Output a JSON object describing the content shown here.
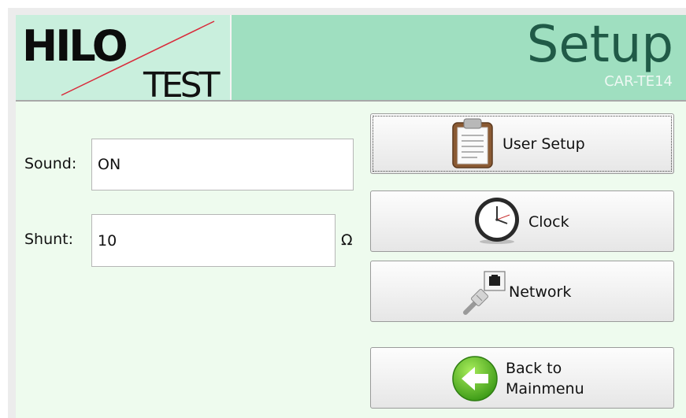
{
  "header": {
    "logo_top": "HILO",
    "logo_bottom": "TEST",
    "title": "Setup",
    "subtitle": "CAR-TE14"
  },
  "fields": {
    "sound_label": "Sound:",
    "sound_value": "ON",
    "shunt_label": "Shunt:",
    "shunt_value": "10",
    "shunt_unit": "Ω"
  },
  "buttons": {
    "user_setup": "User Setup",
    "clock": "Clock",
    "network": "Network",
    "back_line1": "Back to",
    "back_line2": "Mainmenu"
  },
  "icons": {
    "user_setup": "clipboard-icon",
    "clock": "clock-icon",
    "network": "network-plug-icon",
    "back": "back-arrow-icon"
  },
  "colors": {
    "header_bg": "#9fdfc0",
    "logo_bg": "#c9efdd",
    "title": "#205a47",
    "content_bg": "#eefbee"
  }
}
